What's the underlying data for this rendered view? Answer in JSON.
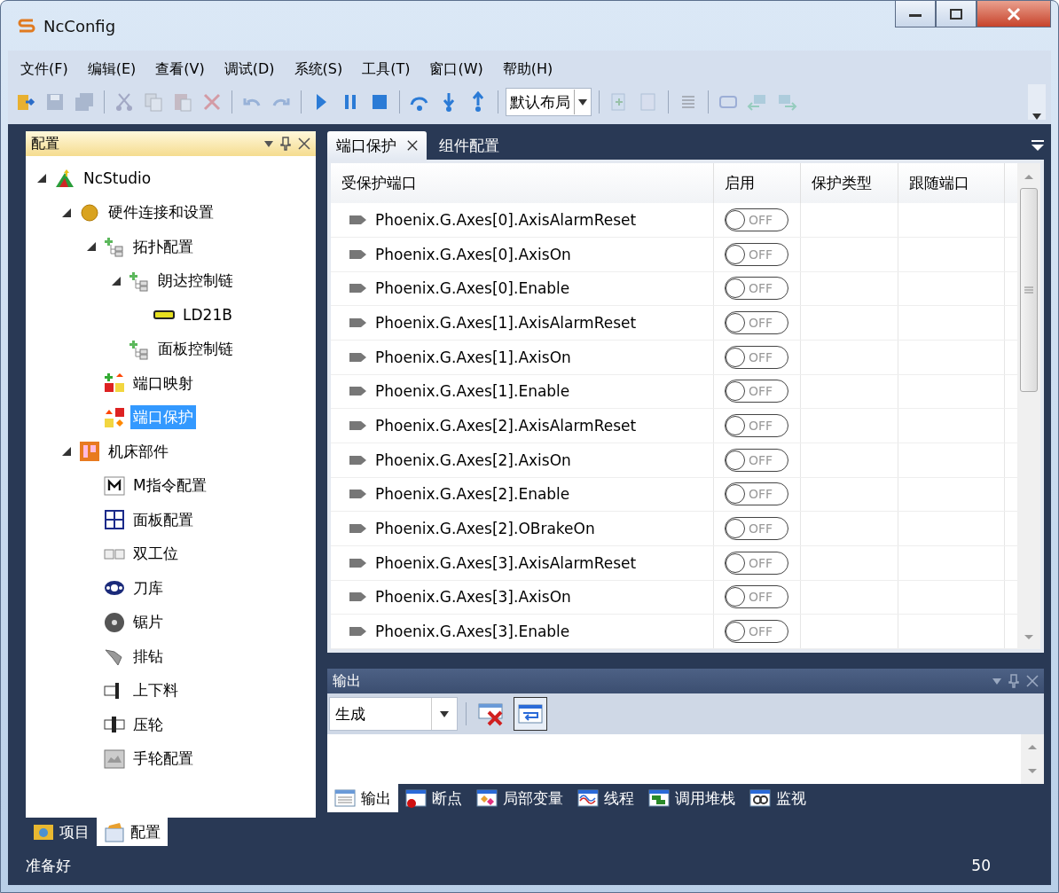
{
  "window": {
    "title": "NcConfig"
  },
  "menu": [
    "文件(F)",
    "编辑(E)",
    "查看(V)",
    "调试(D)",
    "系统(S)",
    "工具(T)",
    "窗口(W)",
    "帮助(H)"
  ],
  "toolbar": [
    {
      "kind": "open",
      "disabled": false
    },
    {
      "kind": "save",
      "disabled": true
    },
    {
      "kind": "saveall",
      "disabled": true
    },
    {
      "kind": "separator"
    },
    {
      "kind": "cut",
      "disabled": true
    },
    {
      "kind": "copy",
      "disabled": true
    },
    {
      "kind": "paste",
      "disabled": true
    },
    {
      "kind": "delete",
      "disabled": true
    },
    {
      "kind": "separator"
    },
    {
      "kind": "undo",
      "disabled": true
    },
    {
      "kind": "redo",
      "disabled": true
    },
    {
      "kind": "separator"
    },
    {
      "kind": "play",
      "disabled": false
    },
    {
      "kind": "pause",
      "disabled": false
    },
    {
      "kind": "stop",
      "disabled": false
    },
    {
      "kind": "separator"
    },
    {
      "kind": "stepover",
      "disabled": false
    },
    {
      "kind": "stepinto",
      "disabled": false
    },
    {
      "kind": "stepout",
      "disabled": false
    },
    {
      "kind": "separator"
    },
    {
      "kind": "layout",
      "value": "默认布局"
    },
    {
      "kind": "separator"
    },
    {
      "kind": "addmenu",
      "disabled": true
    },
    {
      "kind": "doc",
      "disabled": true
    },
    {
      "kind": "separator"
    },
    {
      "kind": "list",
      "disabled": true
    },
    {
      "kind": "separator"
    },
    {
      "kind": "frame",
      "disabled": true
    },
    {
      "kind": "back",
      "disabled": true
    },
    {
      "kind": "forward",
      "disabled": true
    }
  ],
  "left_panel": {
    "title": "配置",
    "tree": [
      {
        "label": "NcStudio",
        "kind": "app",
        "expanded": true,
        "selected": false,
        "children": [
          {
            "label": "硬件连接和设置",
            "kind": "hardware",
            "expanded": true,
            "selected": false,
            "children": [
              {
                "label": "拓扑配置",
                "kind": "topology",
                "expanded": true,
                "selected": false,
                "children": [
                  {
                    "label": "朗达控制链",
                    "kind": "topology",
                    "expanded": true,
                    "selected": false,
                    "children": [
                      {
                        "label": "LD21B",
                        "kind": "device",
                        "selected": false
                      }
                    ]
                  },
                  {
                    "label": "面板控制链",
                    "kind": "topology",
                    "selected": false
                  }
                ]
              },
              {
                "label": "端口映射",
                "kind": "portmap",
                "selected": false
              },
              {
                "label": "端口保护",
                "kind": "portprotect",
                "selected": true
              }
            ]
          },
          {
            "label": "机床部件",
            "kind": "machine",
            "expanded": true,
            "selected": false,
            "children": [
              {
                "label": "M指令配置",
                "kind": "mcode",
                "selected": false
              },
              {
                "label": "面板配置",
                "kind": "panel",
                "selected": false
              },
              {
                "label": "双工位",
                "kind": "dual",
                "selected": false
              },
              {
                "label": "刀库",
                "kind": "toolmag",
                "selected": false
              },
              {
                "label": "锯片",
                "kind": "saw",
                "selected": false
              },
              {
                "label": "排钻",
                "kind": "drill",
                "selected": false
              },
              {
                "label": "上下料",
                "kind": "loader",
                "selected": false
              },
              {
                "label": "压轮",
                "kind": "wheel",
                "selected": false
              },
              {
                "label": "手轮配置",
                "kind": "handwheel",
                "selected": false
              }
            ]
          }
        ]
      }
    ],
    "tabs": [
      {
        "label": "项目",
        "kind": "project",
        "selected": false
      },
      {
        "label": "配置",
        "kind": "config",
        "selected": true
      }
    ]
  },
  "document_tabs": [
    {
      "label": "端口保护",
      "selected": true,
      "closable": true
    },
    {
      "label": "组件配置",
      "selected": false,
      "closable": false
    }
  ],
  "table": {
    "columns": [
      "受保护端口",
      "启用",
      "保护类型",
      "跟随端口"
    ],
    "rows": [
      {
        "port": "Phoenix.G.Axes[0].AxisAlarmReset",
        "switch_label": "OFF",
        "on": false
      },
      {
        "port": "Phoenix.G.Axes[0].AxisOn",
        "switch_label": "OFF",
        "on": false
      },
      {
        "port": "Phoenix.G.Axes[0].Enable",
        "switch_label": "OFF",
        "on": false
      },
      {
        "port": "Phoenix.G.Axes[1].AxisAlarmReset",
        "switch_label": "OFF",
        "on": false
      },
      {
        "port": "Phoenix.G.Axes[1].AxisOn",
        "switch_label": "OFF",
        "on": false
      },
      {
        "port": "Phoenix.G.Axes[1].Enable",
        "switch_label": "OFF",
        "on": false
      },
      {
        "port": "Phoenix.G.Axes[2].AxisAlarmReset",
        "switch_label": "OFF",
        "on": false
      },
      {
        "port": "Phoenix.G.Axes[2].AxisOn",
        "switch_label": "OFF",
        "on": false
      },
      {
        "port": "Phoenix.G.Axes[2].Enable",
        "switch_label": "OFF",
        "on": false
      },
      {
        "port": "Phoenix.G.Axes[2].OBrakeOn",
        "switch_label": "OFF",
        "on": false
      },
      {
        "port": "Phoenix.G.Axes[3].AxisAlarmReset",
        "switch_label": "OFF",
        "on": false
      },
      {
        "port": "Phoenix.G.Axes[3].AxisOn",
        "switch_label": "OFF",
        "on": false
      },
      {
        "port": "Phoenix.G.Axes[3].Enable",
        "switch_label": "OFF",
        "on": false
      }
    ]
  },
  "output_panel": {
    "title": "输出",
    "source": "生成",
    "wrap_on": true,
    "tabs": [
      {
        "label": "输出",
        "kind": "output",
        "selected": true
      },
      {
        "label": "断点",
        "kind": "breakpoint",
        "selected": false
      },
      {
        "label": "局部变量",
        "kind": "locals",
        "selected": false
      },
      {
        "label": "线程",
        "kind": "threads",
        "selected": false
      },
      {
        "label": "调用堆栈",
        "kind": "callstack",
        "selected": false
      },
      {
        "label": "监视",
        "kind": "watch",
        "selected": false
      }
    ]
  },
  "status_bar": {
    "message": "准备好",
    "value": "50"
  }
}
